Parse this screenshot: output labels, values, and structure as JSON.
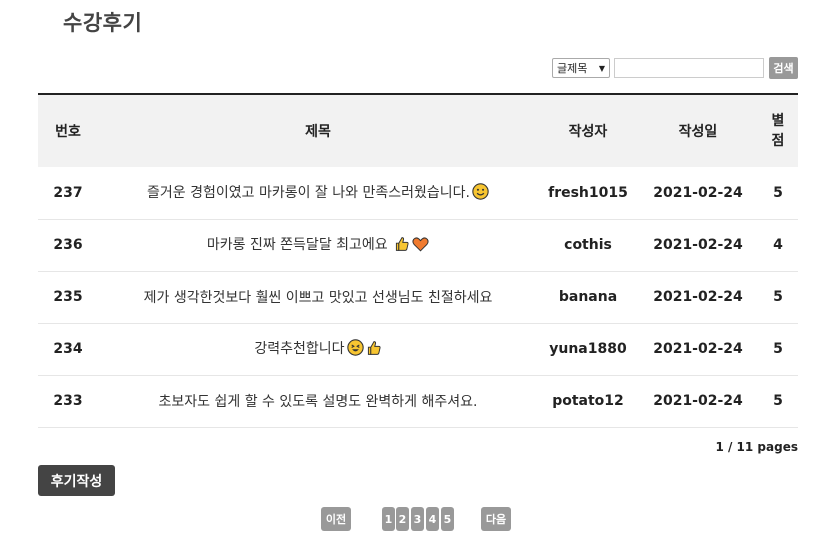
{
  "page": {
    "title": "수강후기"
  },
  "search": {
    "select_value": "글제목",
    "input_value": "",
    "button_label": "검색"
  },
  "table": {
    "headers": {
      "num": "번호",
      "title": "제목",
      "author": "작성자",
      "date": "작성일",
      "score": "별\n점"
    },
    "rows": [
      {
        "num": "237",
        "title": "즐거운 경험이였고 마카롱이 잘 나와 만족스러웠습니다.",
        "icons": [
          "smile-emoji"
        ],
        "author": "fresh1015",
        "date": "2021-02-24",
        "score": "5"
      },
      {
        "num": "236",
        "title": "마카롱 진짜 쫀득달달 최고에요 ",
        "icons": [
          "thumbs-up-emoji",
          "heart-emoji"
        ],
        "author": "cothis",
        "date": "2021-02-24",
        "score": "4"
      },
      {
        "num": "235",
        "title": "제가 생각한것보다 훨씬 이쁘고 맛있고 선생님도 친절하세요",
        "icons": [],
        "author": "banana",
        "date": "2021-02-24",
        "score": "5"
      },
      {
        "num": "234",
        "title": "강력추천합니다",
        "icons": [
          "laughing-emoji",
          "thumbs-up-emoji"
        ],
        "author": "yuna1880",
        "date": "2021-02-24",
        "score": "5"
      },
      {
        "num": "233",
        "title": "초보자도 쉽게 할 수 있도록 설명도 완벽하게 해주셔요.",
        "icons": [],
        "author": "potato12",
        "date": "2021-02-24",
        "score": "5"
      }
    ]
  },
  "pages_info": "1 / 11 pages",
  "write_button": "후기작성",
  "pagination": {
    "prev": "이전",
    "pages": [
      "1",
      "2",
      "3",
      "4",
      "5"
    ],
    "next": "다음"
  },
  "colors": {
    "header_bg": "#f2f2f2",
    "button_dark": "#444444",
    "button_gray": "#999999"
  }
}
